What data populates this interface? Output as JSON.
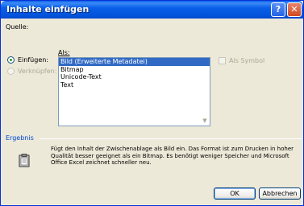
{
  "window": {
    "title": "Inhalte einfügen"
  },
  "titlebar_buttons": {
    "help_glyph": "?",
    "close_glyph": "✕"
  },
  "source": {
    "label": "Quelle:",
    "value": ""
  },
  "as": {
    "label": "Als:"
  },
  "options": {
    "paste_label": "Einfügen:",
    "link_label": "Verknüpfen:",
    "paste_checked": true
  },
  "list": {
    "items": [
      "Bild (Erweiterte Metadatei)",
      "Bitmap",
      "Unicode-Text",
      "Text"
    ],
    "selected_index": 0
  },
  "display_as_icon": {
    "label": "Als Symbol",
    "checked": false
  },
  "result": {
    "label": "Ergebnis",
    "text": "Fügt den Inhalt der Zwischenablage als Bild ein. Das Format ist zum Drucken in hoher Qualität besser geeignet als ein Bitmap. Es benötigt weniger Speicher und Microsoft Office Excel zeichnet schneller neu."
  },
  "buttons": {
    "ok": "OK",
    "cancel": "Abbrechen"
  },
  "icons": {
    "help": "help-icon",
    "close": "close-icon",
    "result": "clipboard-icon"
  }
}
